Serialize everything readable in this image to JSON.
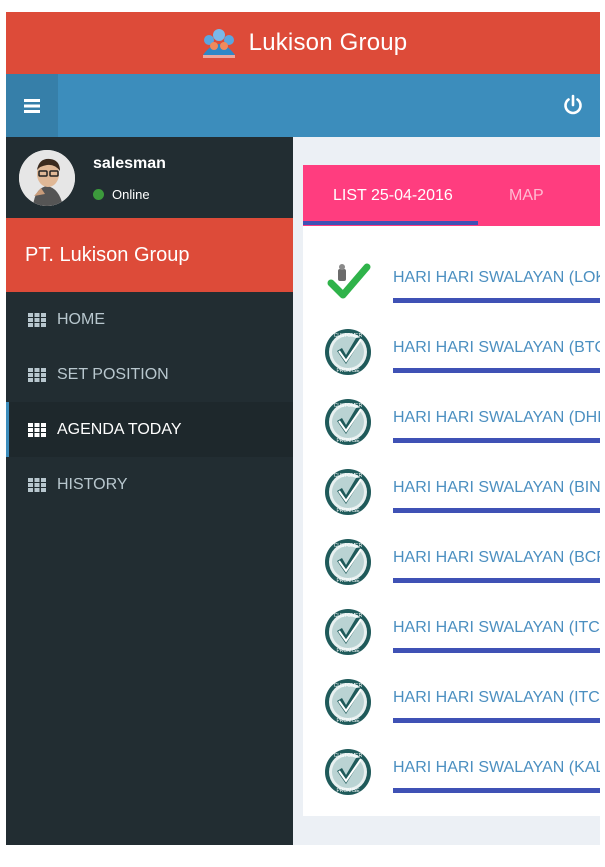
{
  "app": {
    "title": "Lukison Group"
  },
  "navbar": {
    "toggle_icon": "hamburger-icon",
    "power_icon": "power-icon"
  },
  "user": {
    "name": "salesman",
    "status": "Online",
    "status_color": "#3c9a3c"
  },
  "sidebar": {
    "company": "PT. Lukison Group",
    "items": [
      {
        "label": "HOME",
        "icon": "grid-icon"
      },
      {
        "label": "SET POSITION",
        "icon": "grid-icon"
      },
      {
        "label": "AGENDA TODAY",
        "icon": "grid-icon",
        "active": true
      },
      {
        "label": "HISTORY",
        "icon": "grid-icon"
      }
    ]
  },
  "tabs": [
    {
      "label": "LIST 25-04-2016",
      "active": true
    },
    {
      "label": "MAP"
    }
  ],
  "agenda": [
    {
      "name": "HARI HARI SWALAYAN (LOKASARI)",
      "icon": "visited-checkmark-icon"
    },
    {
      "name": "HARI HARI SWALAYAN (BTC)",
      "icon": "customer-promise-badge-icon"
    },
    {
      "name": "HARI HARI SWALAYAN (DHI)",
      "icon": "customer-promise-badge-icon"
    },
    {
      "name": "HARI HARI SWALAYAN (BINTARO)",
      "icon": "customer-promise-badge-icon"
    },
    {
      "name": "HARI HARI SWALAYAN (BCP)",
      "icon": "customer-promise-badge-icon"
    },
    {
      "name": "HARI HARI SWALAYAN (ITC FATMAWATI)",
      "icon": "customer-promise-badge-icon"
    },
    {
      "name": "HARI HARI SWALAYAN (ITC ROXY)",
      "icon": "customer-promise-badge-icon"
    },
    {
      "name": "HARI HARI SWALAYAN (KALIMALANG)",
      "icon": "customer-promise-badge-icon"
    }
  ],
  "colors": {
    "header_red": "#dd4b39",
    "navbar_blue": "#3c8dbc",
    "sidebar_dark": "#222d32",
    "tab_pink": "#ff3d7f",
    "indigo": "#3f51b5",
    "link_blue": "#4b8fc0"
  }
}
